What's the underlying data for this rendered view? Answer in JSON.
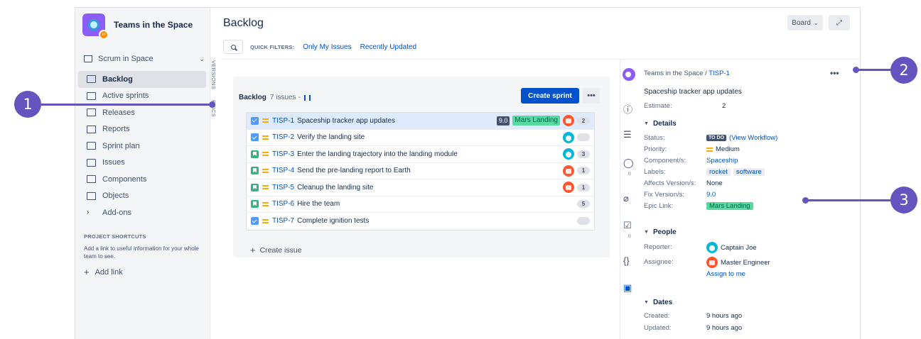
{
  "project": {
    "name": "Teams in the Space"
  },
  "board_select": {
    "label": "Scrum in Space"
  },
  "sidebar": {
    "items": [
      {
        "label": "Backlog",
        "icon": "backlog-icon",
        "active": true
      },
      {
        "label": "Active sprints",
        "icon": "board-icon"
      },
      {
        "label": "Releases",
        "icon": "ship-icon"
      },
      {
        "label": "Reports",
        "icon": "chart-icon"
      },
      {
        "label": "Sprint plan",
        "icon": "calendar-icon"
      },
      {
        "label": "Issues",
        "icon": "inbox-icon"
      },
      {
        "label": "Components",
        "icon": "puzzle-icon"
      },
      {
        "label": "Objects",
        "icon": "tree-icon"
      },
      {
        "label": "Add-ons",
        "icon": "chevron-right-icon"
      }
    ],
    "shortcuts_title": "PROJECT SHORTCUTS",
    "shortcuts_desc": "Add a link to useful information for your whole team to see.",
    "add_link": "Add link"
  },
  "vertical_tabs": {
    "versions": "VERSIONS",
    "epics": "EPICS"
  },
  "header": {
    "title": "Backlog",
    "board_button": "Board",
    "expand_icon": "expand-icon"
  },
  "filters": {
    "label": "QUICK FILTERS:",
    "only_my_issues": "Only My Issues",
    "recently_updated": "Recently Updated"
  },
  "backlog": {
    "title": "Backlog",
    "count": "7 issues",
    "create_sprint": "Create sprint",
    "more": "•••",
    "create_issue": "Create issue",
    "issues": [
      {
        "type": "task",
        "key": "TISP-1",
        "summary": "Spaceship tracker app updates",
        "estimate": "9.0",
        "epic": "Mars Landing",
        "assignee": "orange",
        "count": "2",
        "selected": true
      },
      {
        "type": "task",
        "key": "TISP-2",
        "summary": "Verify the landing site",
        "assignee": "teal",
        "count": ""
      },
      {
        "type": "story",
        "key": "TISP-3",
        "summary": "Enter the landing trajectory into the landing module",
        "assignee": "teal",
        "count": "3"
      },
      {
        "type": "story",
        "key": "TISP-4",
        "summary": "Send the pre-landing report to Earth",
        "assignee": "orange",
        "count": "1"
      },
      {
        "type": "story",
        "key": "TISP-5",
        "summary": "Cleanup the landing site",
        "assignee": "orange",
        "count": "1"
      },
      {
        "type": "story",
        "key": "TISP-6",
        "summary": "Hire the team",
        "count": "5"
      },
      {
        "type": "task",
        "key": "TISP-7",
        "summary": "Complete ignition tests",
        "count": ""
      }
    ]
  },
  "detail": {
    "project": "Teams in the Space",
    "key": "TISP-1",
    "title": "Spaceship tracker app updates",
    "estimate_label": "Estimate:",
    "estimate": "2",
    "details_heading": "Details",
    "status_label": "Status:",
    "status": "TO DO",
    "view_workflow": "(View Workflow)",
    "priority_label": "Priority:",
    "priority": "Medium",
    "component_label": "Component/s:",
    "component": "Spaceship",
    "labels_label": "Labels:",
    "labels": [
      "rocket",
      "software"
    ],
    "affects_label": "Affects Version/s:",
    "affects": "None",
    "fix_label": "Fix Version/s:",
    "fix": "9.0",
    "epic_label": "Epic Link:",
    "epic": "Mars Landing",
    "people_heading": "People",
    "reporter_label": "Reporter:",
    "reporter": "Captain Joe",
    "assignee_label": "Assignee:",
    "assignee": "Master Engineer",
    "assign_to_me": "Assign to me",
    "dates_heading": "Dates",
    "created_label": "Created:",
    "created": "9 hours ago",
    "updated_label": "Updated:",
    "updated": "9 hours ago",
    "tool_counts": {
      "comments": "0",
      "checklist": "0"
    }
  },
  "callouts": [
    "1",
    "2",
    "3"
  ],
  "colors": {
    "accent": "#0052cc",
    "callout": "#6554c0",
    "epic": "#57d9a3"
  }
}
